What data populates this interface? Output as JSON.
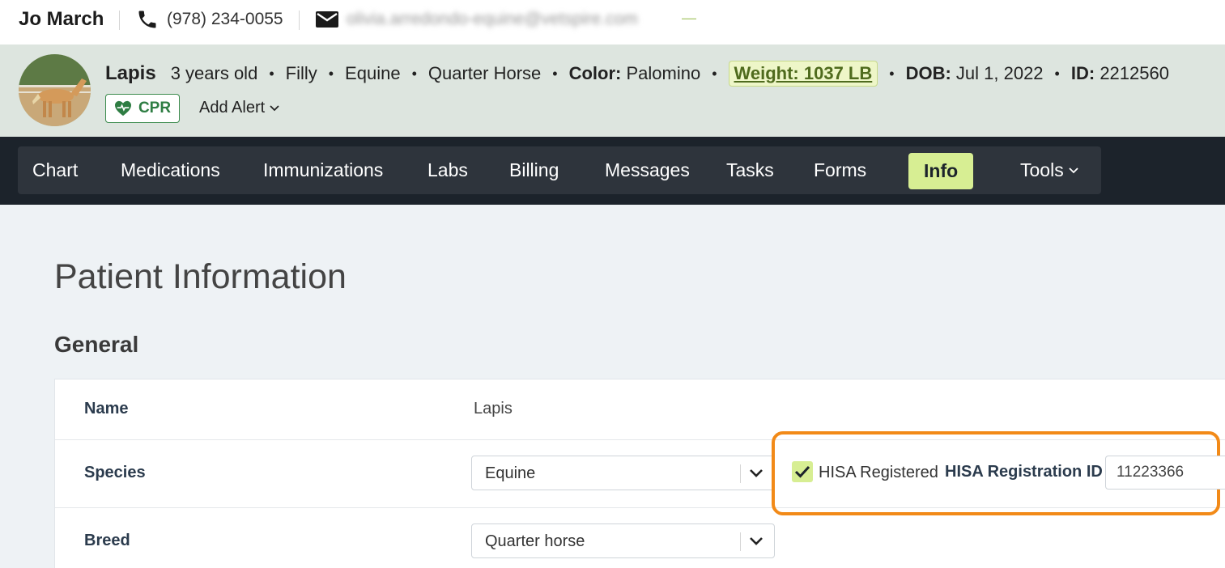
{
  "client": {
    "name": "Jo March",
    "phone": "(978) 234-0055",
    "email": "olivia.arredondo-equine@vetspire.com",
    "extra": "—"
  },
  "patient": {
    "name": "Lapis",
    "age": "3 years old",
    "sex": "Filly",
    "species": "Equine",
    "breed": "Quarter Horse",
    "color_label": "Color:",
    "color": "Palomino",
    "weight": "Weight: 1037 LB",
    "dob_label": "DOB:",
    "dob": "Jul 1, 2022",
    "id_label": "ID:",
    "id": "2212560",
    "separator": "•",
    "cpr_label": "CPR",
    "add_alert_label": "Add Alert"
  },
  "nav": {
    "items": [
      "Chart",
      "Medications",
      "Immunizations",
      "Labs",
      "Billing",
      "Messages",
      "Tasks",
      "Forms",
      "Info",
      "Tools"
    ],
    "active": "Info"
  },
  "main": {
    "page_title": "Patient Information",
    "section_title": "General",
    "rows": [
      {
        "label": "Name",
        "value": "Lapis"
      },
      {
        "label": "Species",
        "value": "Equine"
      },
      {
        "label": "Breed",
        "value": "Quarter horse"
      }
    ],
    "hisa": {
      "checkbox_label": "HISA Registered",
      "checked": true,
      "id_label": "HISA Registration ID",
      "id_value": "11223366"
    }
  },
  "colors": {
    "accent": "#d7ee93",
    "nav_bg": "#1c232b",
    "header_bg": "#dde5df",
    "cpr_green": "#2e7d43",
    "highlight_orange": "#f28a18"
  }
}
